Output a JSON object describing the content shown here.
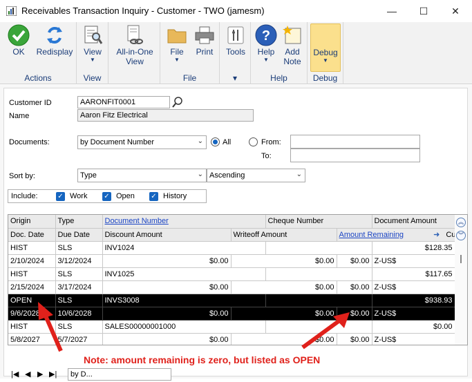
{
  "window": {
    "title": "Receivables Transaction Inquiry - Customer  -  TWO (jamesm)",
    "minimize": "—",
    "maximize": "☐",
    "close": "✕"
  },
  "ribbon": {
    "groups": [
      {
        "label": "Actions"
      },
      {
        "label": "View"
      },
      {
        "label": ""
      },
      {
        "label": "File"
      },
      {
        "label": "Help"
      },
      {
        "label": "Debug"
      }
    ],
    "buttons": {
      "ok": "OK",
      "redisplay": "Redisplay",
      "view": "View",
      "all_in_one_1": "All-in-One",
      "all_in_one_2": "View",
      "file": "File",
      "print": "Print",
      "tools": "Tools",
      "help": "Help",
      "add_note_1": "Add",
      "add_note_2": "Note",
      "debug": "Debug"
    },
    "arrow": "▼",
    "tools_group_arrow": "▾"
  },
  "form": {
    "customer_id_label": "Customer ID",
    "customer_id_value": "AARONFIT0001",
    "name_label": "Name",
    "name_value": "Aaron Fitz Electrical",
    "documents_label": "Documents:",
    "documents_value": "by Document Number",
    "all_label": "All",
    "from_label": "From:",
    "to_label": "To:",
    "sort_by_label": "Sort by:",
    "sort_by_value": "Type",
    "sort_order_value": "Ascending",
    "include_label": "Include:",
    "include_work": "Work",
    "include_open": "Open",
    "include_history": "History",
    "check_mark": "✓"
  },
  "grid": {
    "header1": [
      "Origin",
      "Type",
      "Document Number",
      "Cheque Number",
      "Document Amount"
    ],
    "header2": [
      "Doc. Date",
      "Due Date",
      "Discount Amount",
      "Writeoff Amount",
      "Amount Remaining",
      "Currency ID"
    ],
    "rows": [
      {
        "origin": "HIST",
        "type": "SLS",
        "doc_number": "INV1024",
        "cheque": "",
        "doc_amount": "$128.35",
        "doc_date": "2/10/2024",
        "due_date": "3/12/2024",
        "discount": "$0.00",
        "writeoff": "$0.00",
        "remaining": "$0.00",
        "currency": "Z-US$",
        "selected": false
      },
      {
        "origin": "HIST",
        "type": "SLS",
        "doc_number": "INV1025",
        "cheque": "",
        "doc_amount": "$117.65",
        "doc_date": "2/15/2024",
        "due_date": "3/17/2024",
        "discount": "$0.00",
        "writeoff": "$0.00",
        "remaining": "$0.00",
        "currency": "Z-US$",
        "selected": false
      },
      {
        "origin": "OPEN",
        "type": "SLS",
        "doc_number": "INVS3008",
        "cheque": "",
        "doc_amount": "$938.93",
        "doc_date": "9/6/2028",
        "due_date": "10/6/2028",
        "discount": "$0.00",
        "writeoff": "$0.00",
        "remaining": "$0.00",
        "currency": "Z-US$",
        "selected": true
      },
      {
        "origin": "HIST",
        "type": "SLS",
        "doc_number": "SALES00000001000",
        "cheque": "",
        "doc_amount": "$0.00",
        "doc_date": "5/8/2027",
        "due_date": "5/7/2027",
        "discount": "$0.00",
        "writeoff": "$0.00",
        "remaining": "$0.00",
        "currency": "Z-US$",
        "selected": false
      }
    ]
  },
  "bottom": {
    "nav_first": "|◀",
    "nav_prev": "◀",
    "nav_next": "▶",
    "nav_last": "▶|",
    "browse_by": "by D..."
  },
  "annotation": {
    "note": "Note: amount remaining is zero, but listed as OPEN",
    "color": "#e0211b"
  }
}
